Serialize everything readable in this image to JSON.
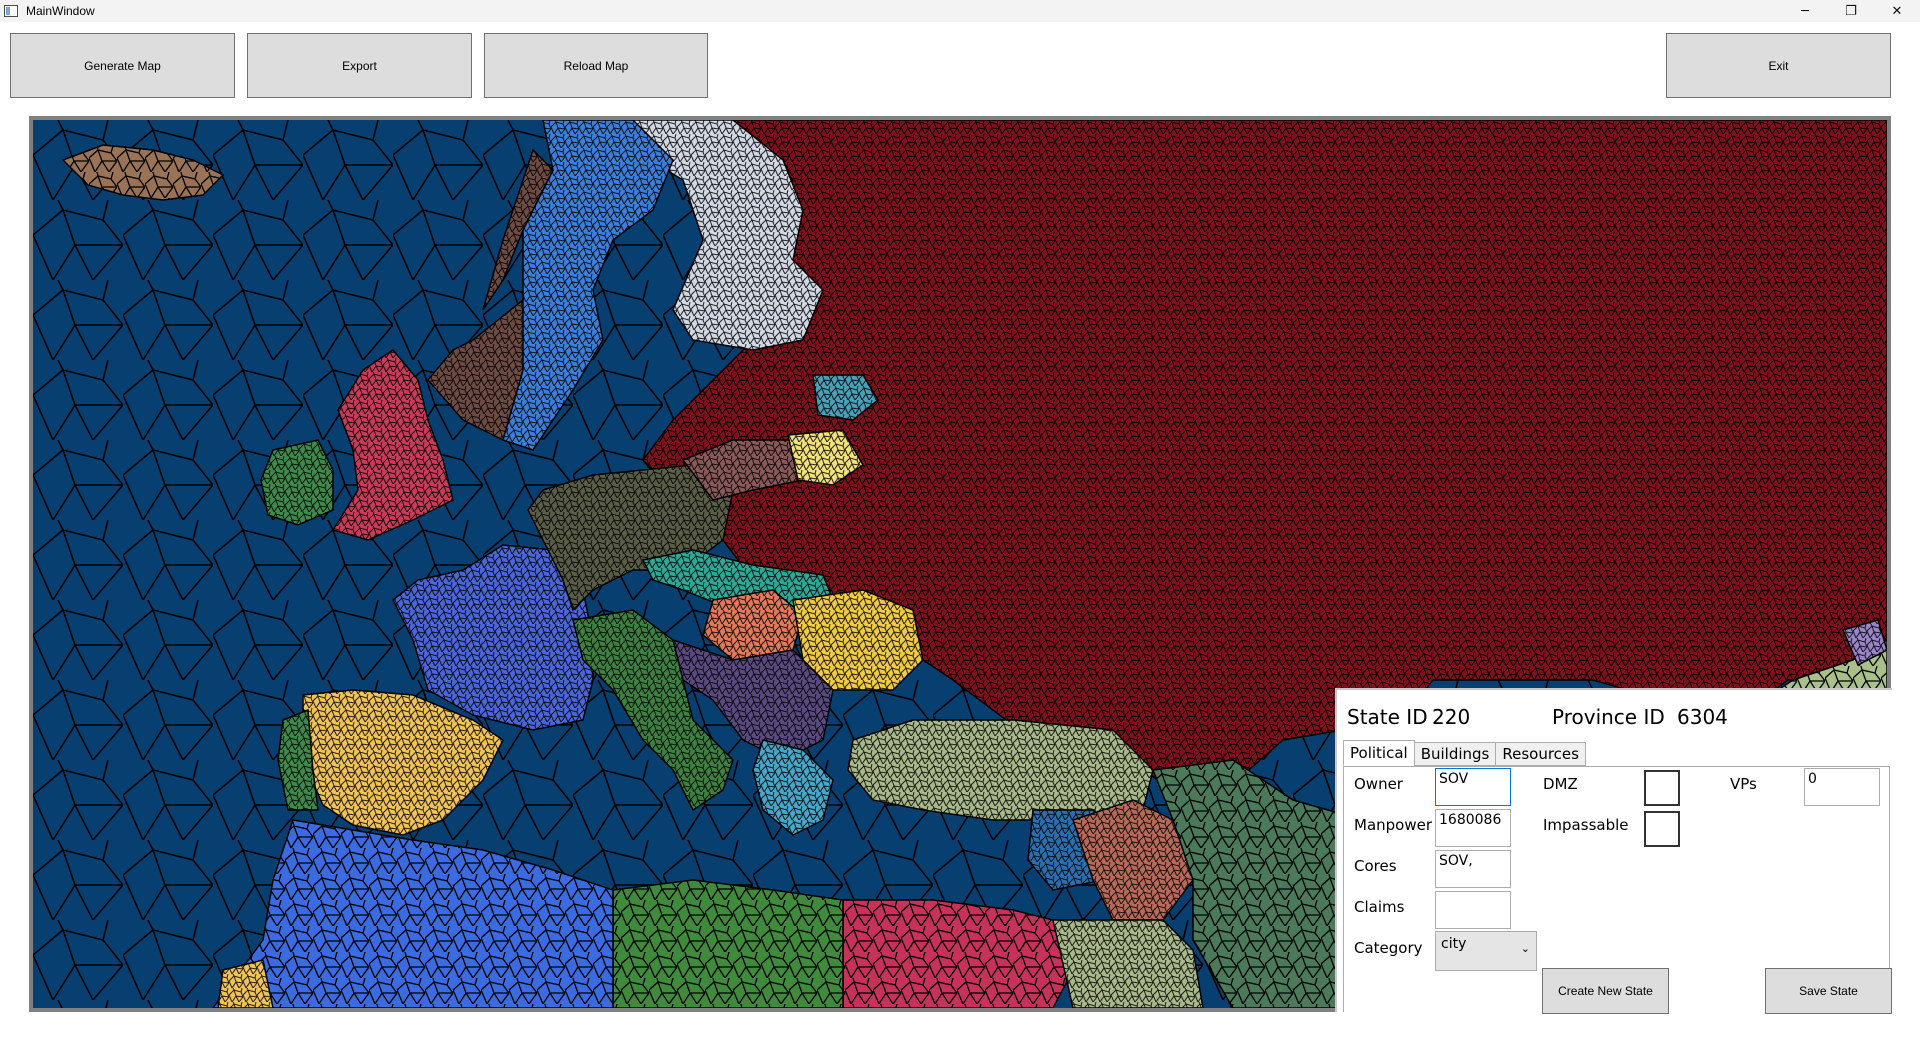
{
  "window": {
    "title": "MainWindow",
    "controls": {
      "minimize": "─",
      "restore": "❐",
      "close": "✕"
    }
  },
  "toolbar": {
    "generate_map": "Generate Map",
    "export": "Export",
    "reload_map": "Reload Map",
    "exit": "Exit"
  },
  "map": {
    "colors": {
      "ocean": "#063f70",
      "soviet": "#7f111a",
      "sweden": "#3b7fd9",
      "finland": "#d2d8e3",
      "norway": "#6e4c43",
      "iceland": "#9a7356",
      "uk": "#c83c59",
      "ireland": "#3f8a4b",
      "france": "#4b66d6",
      "spain": "#f0c25a",
      "portugal": "#3f8a4b",
      "germany": "#5a5e47",
      "italy": "#3e8040",
      "poland": "#8a5a5a",
      "czech": "#2fa898",
      "romania": "#f0c94a",
      "hungary": "#e07a5a",
      "yugoslavia": "#5a4a80",
      "turkey": "#a9b88a",
      "north_africa": "#3b6be0",
      "egypt_libya": "#3f8a3b",
      "arabia": "#c8325a",
      "persia": "#4a7a5a",
      "iraq": "#b86a5a",
      "latvia": "#f2e07a",
      "estonia": "#4aa0b8",
      "greece": "#4aa6c8",
      "caucasus": "#2a70b0",
      "china": "#a9c08a",
      "mongolia": "#9a84c8"
    }
  },
  "panel": {
    "state_id_label": "State ID",
    "state_id_value": "220",
    "province_id_label": "Province ID",
    "province_id_value": "6304",
    "tabs": [
      "Political",
      "Buildings",
      "Resources"
    ],
    "fields": {
      "owner_label": "Owner",
      "owner_value": "SOV",
      "manpower_label": "Manpower",
      "manpower_value": "1680086",
      "cores_label": "Cores",
      "cores_value": "SOV,",
      "claims_label": "Claims",
      "claims_value": "",
      "category_label": "Category",
      "category_value": "city",
      "dmz_label": "DMZ",
      "dmz_checked": false,
      "impassable_label": "Impassable",
      "impassable_checked": false,
      "vps_label": "VPs",
      "vps_value": "0"
    },
    "buttons": {
      "create_new_state": "Create New State",
      "save_state": "Save State"
    }
  }
}
